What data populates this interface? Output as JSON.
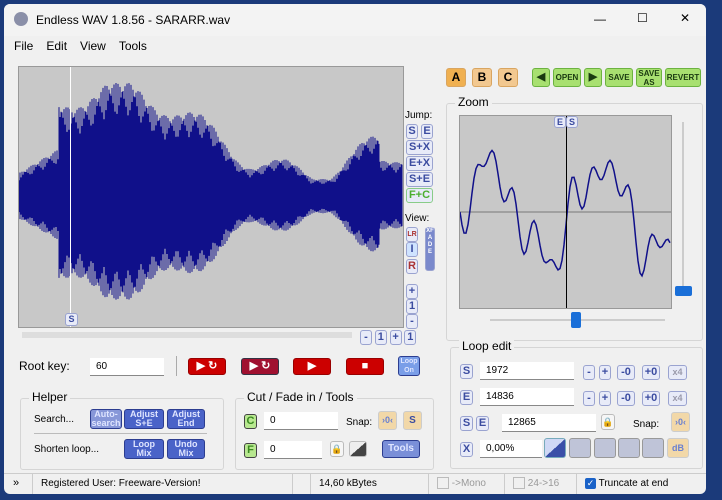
{
  "window": {
    "title": "Endless WAV 1.8.56 - SARARR.wav",
    "minimize": "—",
    "maximize": "☐",
    "close": "✕"
  },
  "menu": [
    "File",
    "Edit",
    "View",
    "Tools"
  ],
  "toolbar": {
    "slots": [
      "A",
      "B",
      "C"
    ],
    "prev": "◀",
    "open": "OPEN",
    "next": "▶",
    "save": "SAVE",
    "save_as": "SAVE AS",
    "revert": "REVERT"
  },
  "jump": {
    "label": "Jump:",
    "buttons": [
      "S",
      "E",
      "S+X",
      "E+X",
      "S+E",
      "F+C"
    ]
  },
  "view": {
    "label": "View:",
    "lr": "LR",
    "i": "I",
    "r": "R",
    "xfade": "XFADE"
  },
  "zoom_btns": {
    "plus": "+",
    "one_a": "1",
    "minus": "-",
    "one_b": "1"
  },
  "wave_scroll": {
    "minus": "-",
    "one_a": "1",
    "plus": "+",
    "one_b": "1"
  },
  "markers": {
    "s": "S",
    "e": "E"
  },
  "zoom": {
    "title": "Zoom"
  },
  "root_key": {
    "label": "Root key:",
    "value": "60"
  },
  "loop_on": "Loop On",
  "helper": {
    "title": "Helper",
    "search": "Search...",
    "auto_search": "Auto-search",
    "adjust_se": "Adjust S+E",
    "adjust_end": "Adjust End",
    "shorten": "Shorten loop...",
    "loop_mix": "Loop Mix",
    "undo_mix": "Undo Mix"
  },
  "cut": {
    "title": "Cut / Fade in / Tools",
    "c_label": "C",
    "c_value": "0",
    "f_label": "F",
    "f_value": "0",
    "snap": "Snap:",
    "tools": "Tools"
  },
  "loop_edit": {
    "title": "Loop edit",
    "s_label": "S",
    "s_value": "1972",
    "e_label": "E",
    "e_value": "14836",
    "len_value": "12865",
    "snap": "Snap:",
    "x_label": "X",
    "x_value": "0,00%",
    "minus": "-",
    "plus": "+",
    "m0": "-0",
    "p0": "+0",
    "x4": "x4",
    "db": "dB"
  },
  "status": {
    "registered": "Registered User: Freeware-Version!",
    "size": "14,60 kBytes",
    "mono": "->Mono",
    "bits": "24->16",
    "truncate": "Truncate at end",
    "truncate_checked": true
  }
}
